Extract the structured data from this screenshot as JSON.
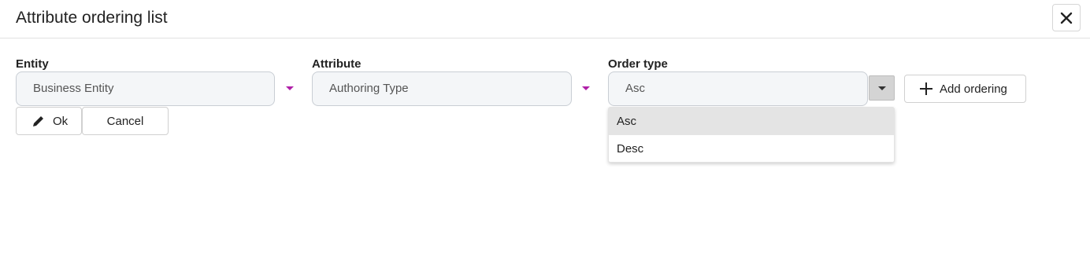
{
  "dialog": {
    "title": "Attribute ordering list",
    "close_icon": "close-icon"
  },
  "fields": {
    "entity": {
      "label": "Entity",
      "value": "Business Entity"
    },
    "attribute": {
      "label": "Attribute",
      "value": "Authoring Type"
    },
    "order_type": {
      "label": "Order type",
      "value": "Asc"
    }
  },
  "buttons": {
    "add_ordering": "Add ordering",
    "ok": "Ok",
    "cancel": "Cancel"
  },
  "order_menu": {
    "options": [
      "Asc",
      "Desc"
    ],
    "selected": "Asc"
  },
  "colors": {
    "caret_accent": "#b01fa8",
    "input_bg": "#f4f6f8",
    "selected_option_bg": "#e4e4e4"
  }
}
